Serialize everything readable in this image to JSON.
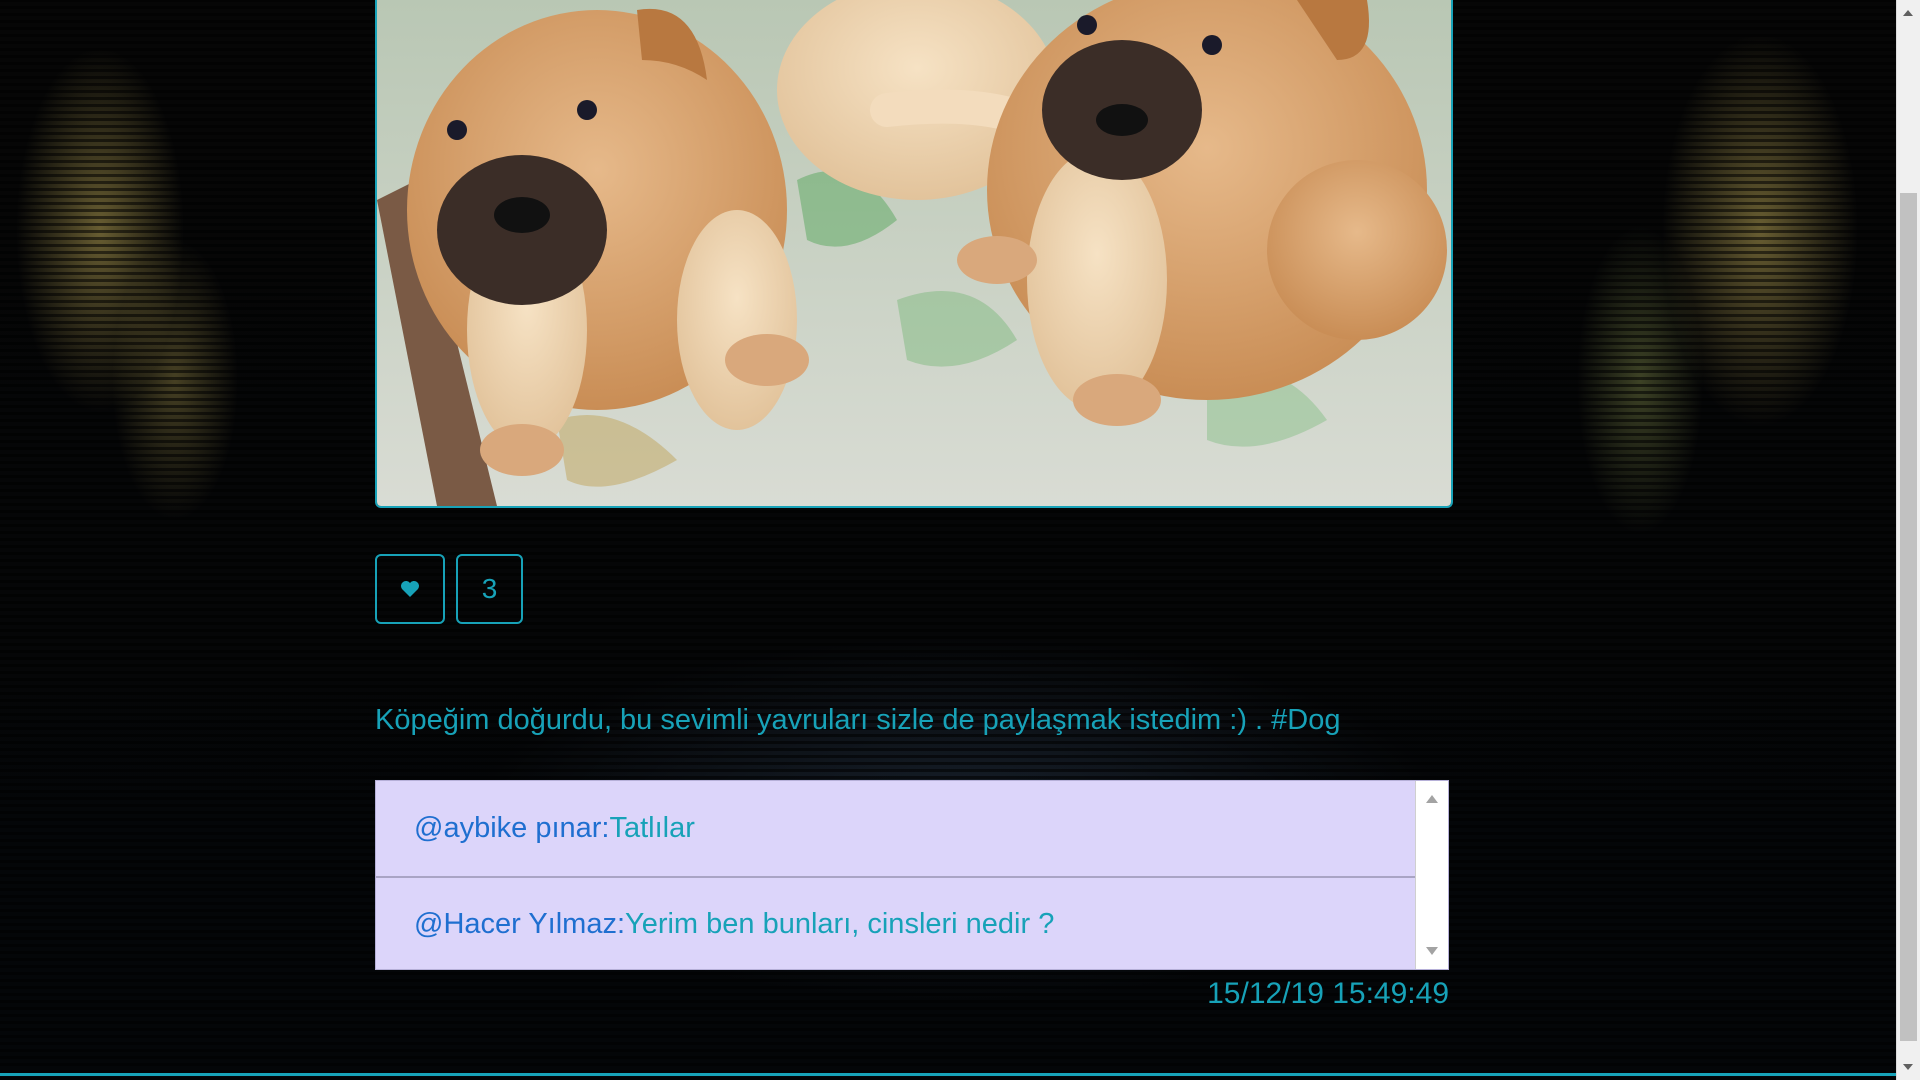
{
  "post": {
    "image_alt": "puppies",
    "like_icon": "heart-icon",
    "like_count": "3",
    "caption": "Köpeğim doğurdu, bu sevimli yavruları sizle de paylaşmak istedim :) . #Dog",
    "timestamp": "15/12/19 15:49:49"
  },
  "comments": [
    {
      "user": "@aybike pınar:",
      "text": " Tatlılar"
    },
    {
      "user": "@Hacer Yılmaz:",
      "text": " Yerim ben bunları, cinsleri nedir ?"
    }
  ],
  "colors": {
    "accent": "#17a2b8",
    "comment_bg": "#dcd5fa",
    "username": "#1f6fd0"
  }
}
